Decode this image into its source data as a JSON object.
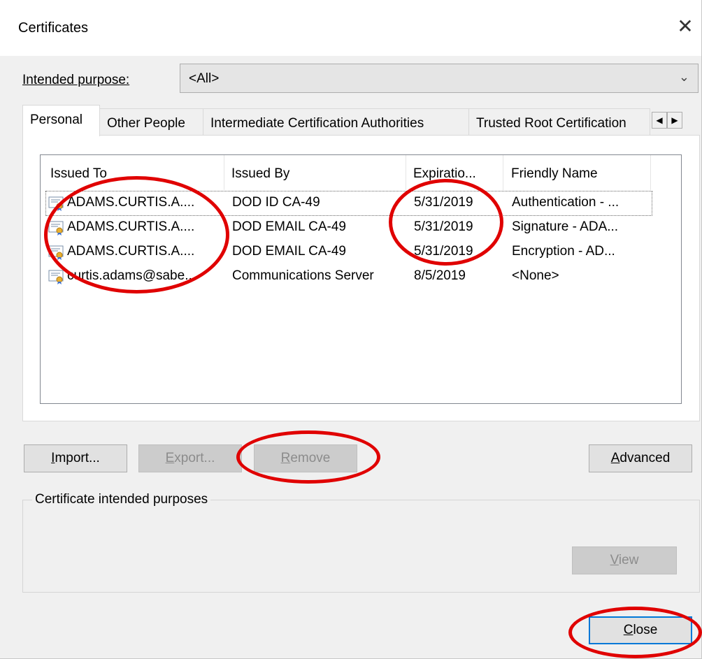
{
  "window": {
    "title": "Certificates",
    "close_glyph": "✕"
  },
  "purpose": {
    "label": "Intended purpose:",
    "value": "<All>"
  },
  "tabs": [
    {
      "label": "Personal"
    },
    {
      "label": "Other People"
    },
    {
      "label": "Intermediate Certification Authorities"
    },
    {
      "label": "Trusted Root Certification"
    }
  ],
  "list": {
    "columns": [
      "Issued To",
      "Issued By",
      "Expiratio...",
      "Friendly Name"
    ],
    "rows": [
      {
        "issued_to": "ADAMS.CURTIS.A....",
        "issued_by": "DOD ID CA-49",
        "expiration": "5/31/2019",
        "friendly_name": "Authentication - ..."
      },
      {
        "issued_to": "ADAMS.CURTIS.A....",
        "issued_by": "DOD EMAIL CA-49",
        "expiration": "5/31/2019",
        "friendly_name": "Signature - ADA..."
      },
      {
        "issued_to": "ADAMS.CURTIS.A....",
        "issued_by": "DOD EMAIL CA-49",
        "expiration": "5/31/2019",
        "friendly_name": "Encryption - AD..."
      },
      {
        "issued_to": "curtis.adams@sabe...",
        "issued_by": "Communications Server",
        "expiration": "8/5/2019",
        "friendly_name": "<None>"
      }
    ]
  },
  "buttons": {
    "import_pre": "I",
    "import_rest": "mport...",
    "export_pre": "E",
    "export_rest": "xport...",
    "remove_pre": "R",
    "remove_rest": "emove",
    "advanced_pre": "A",
    "advanced_rest": "dvanced",
    "view_pre": "V",
    "view_rest": "iew",
    "close_pre": "C",
    "close_rest": "lose"
  },
  "purposes_group": {
    "label": "Certificate intended purposes"
  },
  "annotation_color": "#e00000"
}
